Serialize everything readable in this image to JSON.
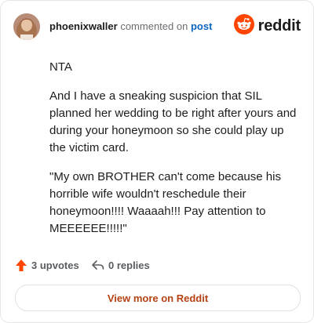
{
  "header": {
    "username": "phoenixwaller",
    "commented_on": "commented on",
    "post_link": "post",
    "brand": "reddit"
  },
  "comment": {
    "paragraphs": [
      "NTA",
      "And I have a sneaking suspicion that SIL planned her wedding to be right after yours and during your honeymoon so she could play up the victim card.",
      "\"My own BROTHER can't come because his horrible wife wouldn't reschedule their honeymoon!!!! Waaaah!!! Pay attention to MEEEEEE!!!!!\""
    ]
  },
  "actions": {
    "upvotes": "3 upvotes",
    "replies": "0 replies"
  },
  "footer": {
    "view_more": "View more on Reddit"
  },
  "colors": {
    "brand": "#ff4500",
    "upvote": "#ff4500",
    "link": "#0a66c2",
    "view_more": "#b54212"
  },
  "icons": {
    "upvote": "upvote-arrow-icon",
    "reply": "reply-arrow-icon",
    "logo": "reddit-snoo-icon"
  }
}
